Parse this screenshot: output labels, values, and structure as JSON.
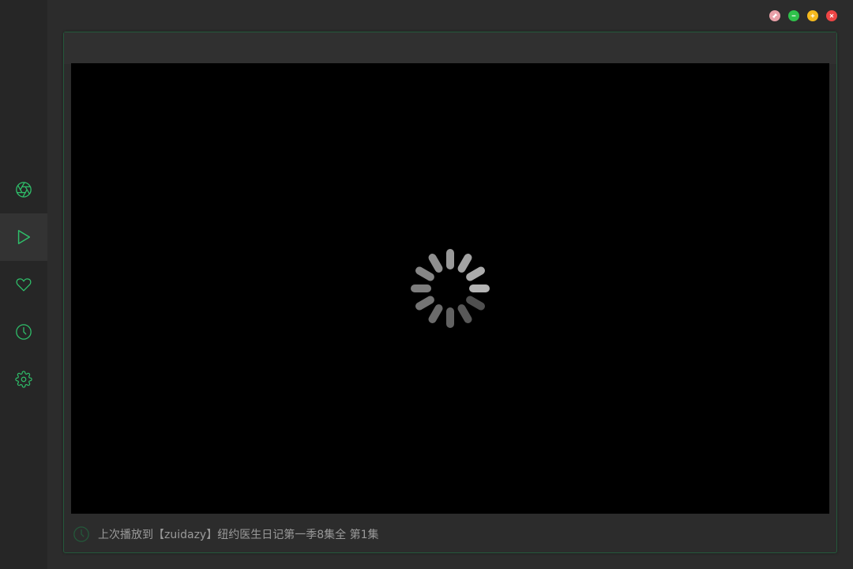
{
  "window_controls": {
    "pin_color": "#e8a0a8",
    "minimize_color": "#2fc14b",
    "maximize_color": "#f5b91e",
    "close_color": "#ee4545"
  },
  "sidebar": {
    "accent_color": "#2fbf6a",
    "active_background": "#333333",
    "items": [
      {
        "icon": "aperture-icon",
        "active": false
      },
      {
        "icon": "play-icon",
        "active": true
      },
      {
        "icon": "heart-icon",
        "active": false
      },
      {
        "icon": "clock-icon",
        "active": false
      },
      {
        "icon": "gear-icon",
        "active": false
      }
    ]
  },
  "player": {
    "state": "loading",
    "loading_icon": "spinner-icon"
  },
  "history": {
    "icon": "clock-icon",
    "text": "上次播放到【zuidazy】纽约医生日记第一季8集全 第1集"
  }
}
